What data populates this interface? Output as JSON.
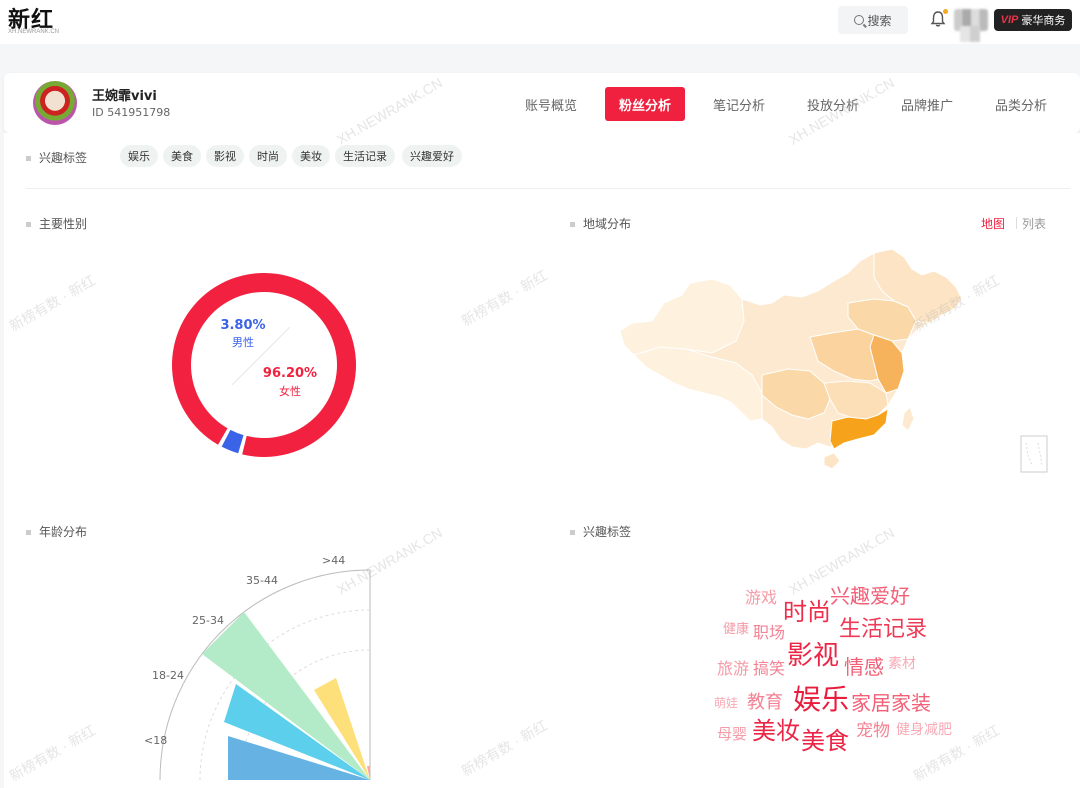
{
  "header": {
    "logo": "新红",
    "logo_sub": "XH.NEWRANK.CN",
    "search_label": "搜索",
    "vip_tag": "VIP",
    "vip_label": "豪华商务",
    "colors": {
      "accent": "#f0213f",
      "vip_bg": "#222222"
    }
  },
  "profile": {
    "name": "王婉霏vivi",
    "id_label": "ID",
    "id": "541951798",
    "tabs": [
      {
        "label": "账号概览",
        "active": false
      },
      {
        "label": "粉丝分析",
        "active": true
      },
      {
        "label": "笔记分析",
        "active": false
      },
      {
        "label": "投放分析",
        "active": false
      },
      {
        "label": "品牌推广",
        "active": false
      },
      {
        "label": "品类分析",
        "active": false
      }
    ]
  },
  "interest_tags": {
    "label": "兴趣标签",
    "tags": [
      "娱乐",
      "美食",
      "影视",
      "时尚",
      "美妆",
      "生活记录",
      "兴趣爱好"
    ]
  },
  "gender": {
    "title": "主要性别",
    "colors": {
      "male": "#3a63e8",
      "female": "#f2213f"
    },
    "chart_data": {
      "type": "pie",
      "categories": [
        "男性",
        "女性"
      ],
      "values": [
        3.8,
        96.2
      ],
      "value_labels": [
        "3.80%",
        "96.20%"
      ]
    }
  },
  "region": {
    "title": "地域分布",
    "toggle": [
      {
        "label": "地图",
        "active": true
      },
      {
        "label": "列表",
        "active": false
      }
    ],
    "colors": {
      "low": "#fde9cf",
      "mid": "#fbd39f",
      "high": "#f7b35c",
      "top": "#f7a21b"
    }
  },
  "age": {
    "title": "年龄分布",
    "chart_data": {
      "type": "bar",
      "categories": [
        "<18",
        "18-24",
        "25-34",
        "35-44",
        ">44"
      ],
      "colors": [
        "#66b3e3",
        "#5ccfec",
        "#b3ebc8",
        "#fde07a",
        "#f9a89d"
      ]
    }
  },
  "interest_cloud": {
    "title": "兴趣标签",
    "words": [
      {
        "text": "游戏",
        "color": "#f59aa6"
      },
      {
        "text": "兴趣爱好",
        "color": "#f25f76"
      },
      {
        "text": "时尚",
        "color": "#ee2f4c"
      },
      {
        "text": "健康",
        "color": "#f59aa6"
      },
      {
        "text": "职场",
        "color": "#f48294"
      },
      {
        "text": "生活记录",
        "color": "#ee3a56"
      },
      {
        "text": "旅游",
        "color": "#f59aa6"
      },
      {
        "text": "搞笑",
        "color": "#f48294"
      },
      {
        "text": "影视",
        "color": "#ec2445"
      },
      {
        "text": "情感",
        "color": "#f25f76"
      },
      {
        "text": "素材",
        "color": "#f7aab5"
      },
      {
        "text": "萌娃",
        "color": "#f7aab5"
      },
      {
        "text": "教育",
        "color": "#f48294"
      },
      {
        "text": "娱乐",
        "color": "#e91c3d"
      },
      {
        "text": "家居家装",
        "color": "#f25f76"
      },
      {
        "text": "母婴",
        "color": "#f59aa6"
      },
      {
        "text": "美妆",
        "color": "#ec2445"
      },
      {
        "text": "美食",
        "color": "#ec2445"
      },
      {
        "text": "宠物",
        "color": "#f48294"
      },
      {
        "text": "健身减肥",
        "color": "#f7aab5"
      }
    ]
  },
  "watermarks": {
    "site": "XH.NEWRANK.CN",
    "brand": "新榜有数 · 新红"
  }
}
